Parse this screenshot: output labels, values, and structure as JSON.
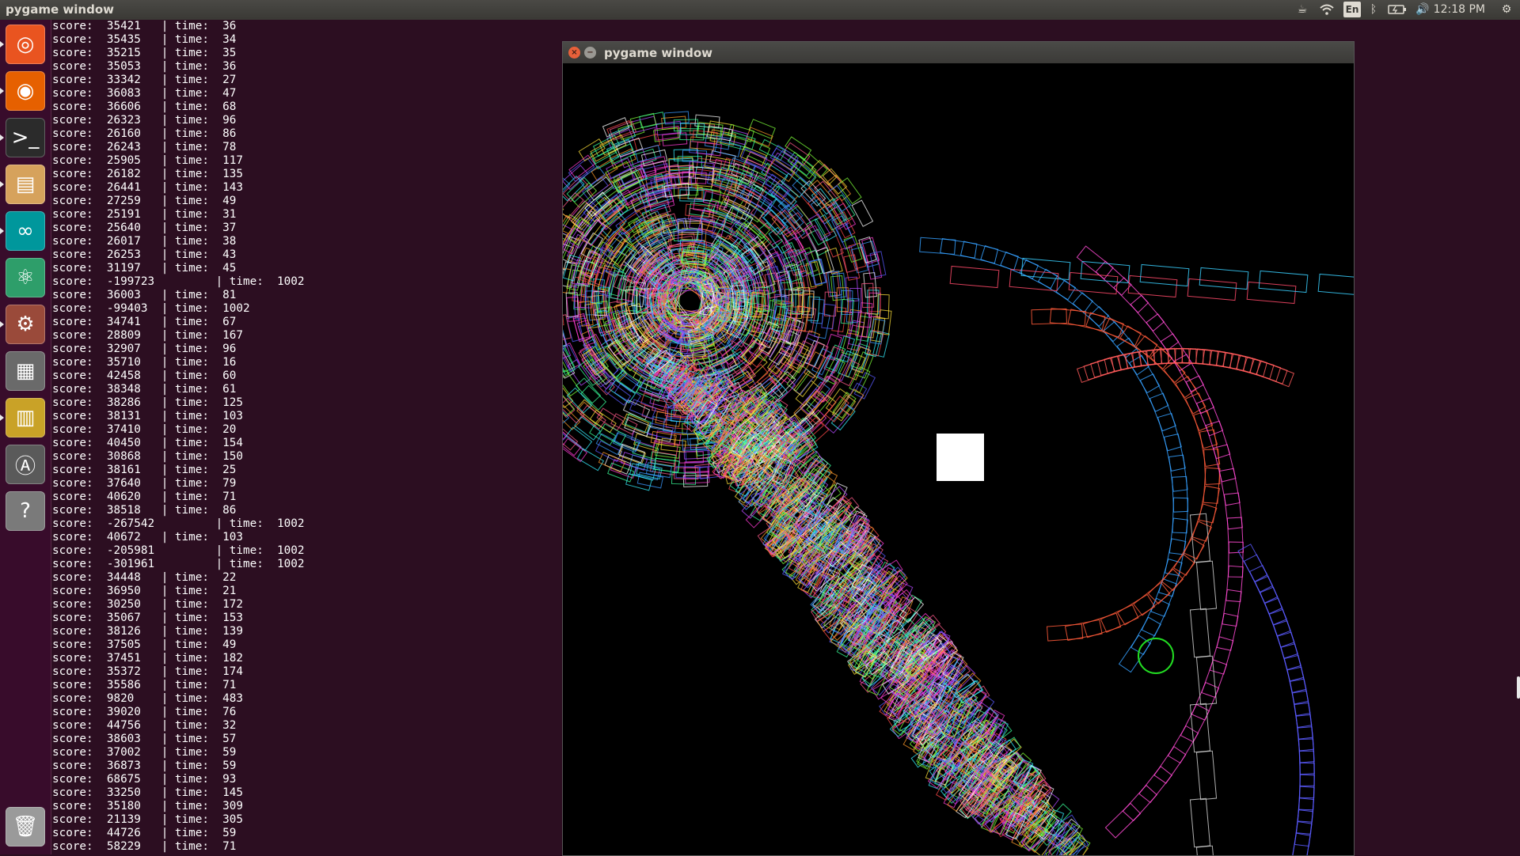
{
  "topbar": {
    "window_title": "pygame window",
    "keyboard_layout": "En",
    "clock": "12:18 PM",
    "indicators": [
      "coffee-icon",
      "wifi-icon",
      "keyboard-layout",
      "bluetooth-icon",
      "battery-icon",
      "volume-icon",
      "gear-icon"
    ]
  },
  "launcher": {
    "items": [
      {
        "name": "ubuntu-dash-icon",
        "color": "#e95420",
        "glyph": "◎"
      },
      {
        "name": "firefox-icon",
        "color": "#e66000",
        "glyph": "◉"
      },
      {
        "name": "terminal-icon",
        "color": "#2b2b2b",
        "glyph": ">_"
      },
      {
        "name": "files-icon",
        "color": "#d6a25c",
        "glyph": "▤"
      },
      {
        "name": "arduino-icon",
        "color": "#00979c",
        "glyph": "∞"
      },
      {
        "name": "atom-icon",
        "color": "#2e9e6a",
        "glyph": "⚛"
      },
      {
        "name": "system-settings-icon",
        "color": "#9a4a3a",
        "glyph": "⚙"
      },
      {
        "name": "workspace-switcher-icon",
        "color": "#6a6a6a",
        "glyph": "▦"
      },
      {
        "name": "paste-jar-icon",
        "color": "#c9a227",
        "glyph": "▥"
      },
      {
        "name": "software-updater-icon",
        "color": "#5a5a5a",
        "glyph": "Ⓐ"
      },
      {
        "name": "help-icon",
        "color": "#7a7a7a",
        "glyph": "?"
      }
    ],
    "trash": {
      "name": "trash-icon",
      "color": "#9a9a9a",
      "glyph": "🗑"
    }
  },
  "terminal": {
    "lines": [
      "score:  35421   | time:  36",
      "score:  35435   | time:  34",
      "score:  35215   | time:  35",
      "score:  35053   | time:  36",
      "score:  33342   | time:  27",
      "score:  36083   | time:  47",
      "score:  36606   | time:  68",
      "score:  26323   | time:  96",
      "score:  26160   | time:  86",
      "score:  26243   | time:  78",
      "score:  25905   | time:  117",
      "score:  26182   | time:  135",
      "score:  26441   | time:  143",
      "score:  27259   | time:  49",
      "score:  25191   | time:  31",
      "score:  25640   | time:  37",
      "score:  26017   | time:  38",
      "score:  26253   | time:  43",
      "score:  31197   | time:  45",
      "score:  -199723         | time:  1002",
      "score:  36003   | time:  81",
      "score:  -99403  | time:  1002",
      "score:  34741   | time:  67",
      "score:  28809   | time:  167",
      "score:  32907   | time:  96",
      "score:  35710   | time:  16",
      "score:  42458   | time:  60",
      "score:  38348   | time:  61",
      "score:  38286   | time:  125",
      "score:  38131   | time:  103",
      "score:  37410   | time:  20",
      "score:  40450   | time:  154",
      "score:  30868   | time:  150",
      "score:  38161   | time:  25",
      "score:  37640   | time:  79",
      "score:  40620   | time:  71",
      "score:  38518   | time:  86",
      "score:  -267542         | time:  1002",
      "score:  40672   | time:  103",
      "score:  -205981         | time:  1002",
      "score:  -301961         | time:  1002",
      "score:  34448   | time:  22",
      "score:  36950   | time:  21",
      "score:  30250   | time:  172",
      "score:  35067   | time:  153",
      "score:  38126   | time:  139",
      "score:  37505   | time:  49",
      "score:  37451   | time:  182",
      "score:  35372   | time:  174",
      "score:  35586   | time:  71",
      "score:  9820    | time:  483",
      "score:  39020   | time:  76",
      "score:  44756   | time:  32",
      "score:  38603   | time:  57",
      "score:  37002   | time:  59",
      "score:  36873   | time:  59",
      "score:  68675   | time:  93",
      "score:  33250   | time:  145",
      "score:  35180   | time:  309",
      "score:  21139   | time:  305",
      "score:  44726   | time:  59",
      "score:  58229   | time:  71"
    ]
  },
  "pygame_window": {
    "title": "pygame window",
    "close_glyph": "×",
    "minimize_glyph": "−",
    "background": "#000000",
    "trail_palette": [
      "#ff3bd4",
      "#35f0ff",
      "#7dff3a",
      "#ff4a4a",
      "#5a5aff",
      "#ffffff",
      "#ff9a2a",
      "#b44aff",
      "#3aff9a",
      "#ffe13a",
      "#ff5a8a",
      "#3a9aff"
    ]
  }
}
